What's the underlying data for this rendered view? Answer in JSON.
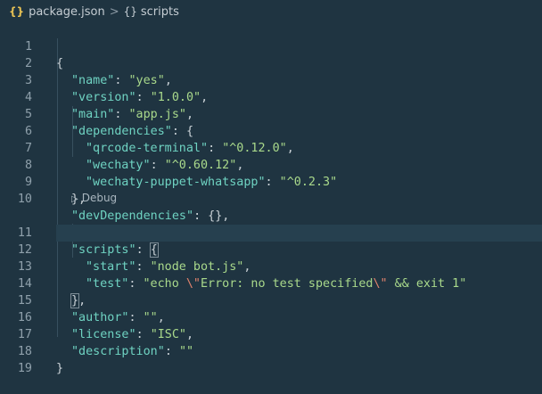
{
  "breadcrumb": {
    "file_icon": "{}",
    "file": "package.json",
    "separator": ">",
    "symbol_icon": "{}",
    "symbol": "scripts"
  },
  "editor": {
    "codelens": "Debug",
    "line_numbers": [
      "1",
      "2",
      "3",
      "4",
      "5",
      "6",
      "7",
      "8",
      "9",
      "10",
      "11",
      "12",
      "13",
      "14",
      "15",
      "16",
      "17",
      "18",
      "19"
    ],
    "lines": {
      "l1": "{",
      "l2": [
        "\"name\"",
        ": ",
        "\"yes\"",
        ","
      ],
      "l3": [
        "\"version\"",
        ": ",
        "\"1.0.0\"",
        ","
      ],
      "l4": [
        "\"main\"",
        ": ",
        "\"app.js\"",
        ","
      ],
      "l5": [
        "\"dependencies\"",
        ": {"
      ],
      "l6": [
        "\"qrcode-terminal\"",
        ": ",
        "\"^0.12.0\"",
        ","
      ],
      "l7": [
        "\"wechaty\"",
        ": ",
        "\"^0.60.12\"",
        ","
      ],
      "l8": [
        "\"wechaty-puppet-whatsapp\"",
        ": ",
        "\"^0.2.3\""
      ],
      "l9": "},",
      "l10": [
        "\"devDependencies\"",
        ": {},"
      ],
      "l11": [
        "\"scripts\"",
        ": ",
        "{"
      ],
      "l12": [
        "\"start\"",
        ": ",
        "\"node bot.js\"",
        ","
      ],
      "l13": [
        "\"test\"",
        ": ",
        "\"echo ",
        "\\\"",
        "Error: no test specified",
        "\\\"",
        " && exit 1\""
      ],
      "l14": [
        "}",
        ","
      ],
      "l15": [
        "\"author\"",
        ": ",
        "\"\"",
        ","
      ],
      "l16": [
        "\"license\"",
        ": ",
        "\"ISC\"",
        ","
      ],
      "l17": [
        "\"description\"",
        ": ",
        "\"\""
      ],
      "l18": "}"
    }
  },
  "colors": {
    "background": "#1f3441",
    "key": "#6fd3c2",
    "string": "#a9d98b",
    "escape": "#e0826c",
    "json_icon": "#e8c254"
  }
}
